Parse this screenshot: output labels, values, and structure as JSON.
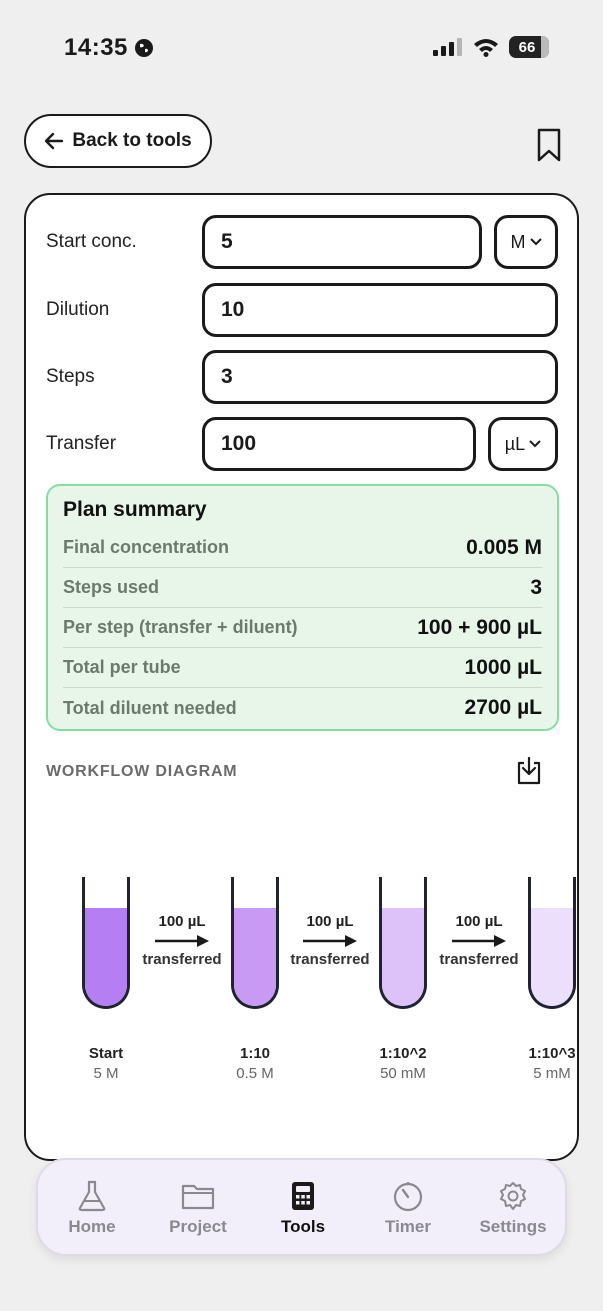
{
  "status": {
    "time": "14:35",
    "battery": "66"
  },
  "nav": {
    "back_label": "Back to tools"
  },
  "form": {
    "start_conc": {
      "label": "Start conc.",
      "value": "5",
      "unit": "M"
    },
    "dilution": {
      "label": "Dilution",
      "value": "10"
    },
    "steps": {
      "label": "Steps",
      "value": "3"
    },
    "transfer": {
      "label": "Transfer",
      "value": "100",
      "unit": "µL"
    }
  },
  "summary": {
    "title": "Plan summary",
    "rows": [
      {
        "label": "Final concentration",
        "value": "0.005 M"
      },
      {
        "label": "Steps used",
        "value": "3"
      },
      {
        "label": "Per step (transfer + diluent)",
        "value": "100 + 900 µL"
      },
      {
        "label": "Total per tube",
        "value": "1000 µL"
      },
      {
        "label": "Total diluent needed",
        "value": "2700 µL"
      }
    ]
  },
  "workflow": {
    "title": "WORKFLOW DIAGRAM",
    "tubes": [
      {
        "name": "Start",
        "conc": "5 M",
        "color": "#b57ef2"
      },
      {
        "name": "1:10",
        "conc": "0.5 M",
        "color": "#c99af4"
      },
      {
        "name": "1:10^2",
        "conc": "50 mM",
        "color": "#dcc2f8"
      },
      {
        "name": "1:10^3",
        "conc": "5 mM",
        "color": "#ecdffb"
      }
    ],
    "transfers": [
      {
        "amount": "100 µL",
        "label": "transferred"
      },
      {
        "amount": "100 µL",
        "label": "transferred"
      },
      {
        "amount": "100 µL",
        "label": "transferred"
      }
    ]
  },
  "tabs": [
    {
      "label": "Home",
      "icon": "flask-icon"
    },
    {
      "label": "Project",
      "icon": "folder-icon"
    },
    {
      "label": "Tools",
      "icon": "calculator-icon",
      "active": true
    },
    {
      "label": "Timer",
      "icon": "timer-icon"
    },
    {
      "label": "Settings",
      "icon": "gear-icon"
    }
  ]
}
